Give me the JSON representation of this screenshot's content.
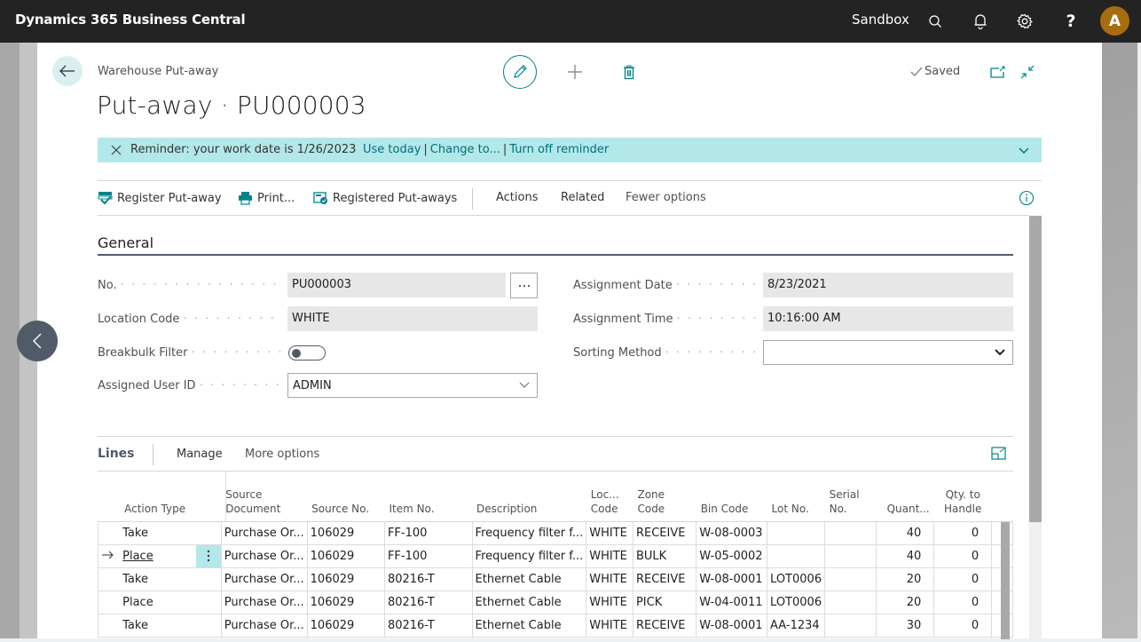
{
  "appbar": {
    "title": "Dynamics 365 Business Central",
    "environment": "Sandbox",
    "icons": [
      "search-icon",
      "bell-icon",
      "gear-icon",
      "help-icon"
    ],
    "help_glyph": "?",
    "avatar_initial": "A",
    "avatar_color": "#a86c10"
  },
  "header": {
    "breadcrumb": "Warehouse Put-away",
    "title": "Put-away · PU000003",
    "status": "Saved",
    "accent_color": "#00838a"
  },
  "reminder": {
    "message": "Reminder: your work date is 1/26/2023",
    "links": [
      "Use today",
      "Change to...",
      "Turn off reminder"
    ],
    "background": "#b3e8ea"
  },
  "actions": {
    "register": "Register Put-away",
    "print": "Print...",
    "registered": "Registered Put-aways",
    "actions": "Actions",
    "related": "Related",
    "fewer": "Fewer options"
  },
  "general": {
    "title": "General",
    "fields": {
      "no": {
        "label": "No.",
        "value": "PU000003"
      },
      "location_code": {
        "label": "Location Code",
        "value": "WHITE"
      },
      "breakbulk_filter": {
        "label": "Breakbulk Filter",
        "value": false
      },
      "assigned_user_id": {
        "label": "Assigned User ID",
        "value": "ADMIN"
      },
      "assignment_date": {
        "label": "Assignment Date",
        "value": "8/23/2021"
      },
      "assignment_time": {
        "label": "Assignment Time",
        "value": "10:16:00 AM"
      },
      "sorting_method": {
        "label": "Sorting Method",
        "value": ""
      }
    },
    "dots": "· · · · · · · · · · · · · · · · · · · · · · · · ·"
  },
  "lines": {
    "title": "Lines",
    "manage": "Manage",
    "more_options": "More options",
    "columns": [
      {
        "key": "action_type",
        "label": "Action Type"
      },
      {
        "key": "source_document",
        "label": "Source Document"
      },
      {
        "key": "source_no",
        "label": "Source No."
      },
      {
        "key": "item_no",
        "label": "Item No."
      },
      {
        "key": "description",
        "label": "Description"
      },
      {
        "key": "loc_code",
        "label": "Loc... Code"
      },
      {
        "key": "zone_code",
        "label": "Zone Code"
      },
      {
        "key": "bin_code",
        "label": "Bin Code"
      },
      {
        "key": "lot_no",
        "label": "Lot No."
      },
      {
        "key": "serial_no",
        "label": "Serial No."
      },
      {
        "key": "quantity",
        "label": "Quant..."
      },
      {
        "key": "qty_to_handle",
        "label": "Qty. to Handle"
      }
    ],
    "rows": [
      {
        "action_type": "Take",
        "source_document": "Purchase Or...",
        "source_no": "106029",
        "item_no": "FF-100",
        "description": "Frequency filter f...",
        "loc_code": "WHITE",
        "zone_code": "RECEIVE",
        "bin_code": "W-08-0003",
        "lot_no": "",
        "serial_no": "",
        "quantity": "40",
        "qty_to_handle": "0"
      },
      {
        "action_type": "Place",
        "source_document": "Purchase Or...",
        "source_no": "106029",
        "item_no": "FF-100",
        "description": "Frequency filter f...",
        "loc_code": "WHITE",
        "zone_code": "BULK",
        "bin_code": "W-05-0002",
        "lot_no": "",
        "serial_no": "",
        "quantity": "40",
        "qty_to_handle": "0"
      },
      {
        "action_type": "Take",
        "source_document": "Purchase Or...",
        "source_no": "106029",
        "item_no": "80216-T",
        "description": "Ethernet Cable",
        "loc_code": "WHITE",
        "zone_code": "RECEIVE",
        "bin_code": "W-08-0001",
        "lot_no": "LOT0006",
        "serial_no": "",
        "quantity": "20",
        "qty_to_handle": "0"
      },
      {
        "action_type": "Place",
        "source_document": "Purchase Or...",
        "source_no": "106029",
        "item_no": "80216-T",
        "description": "Ethernet Cable",
        "loc_code": "WHITE",
        "zone_code": "PICK",
        "bin_code": "W-04-0011",
        "lot_no": "LOT0006",
        "serial_no": "",
        "quantity": "20",
        "qty_to_handle": "0"
      },
      {
        "action_type": "Take",
        "source_document": "Purchase Or...",
        "source_no": "106029",
        "item_no": "80216-T",
        "description": "Ethernet Cable",
        "loc_code": "WHITE",
        "zone_code": "RECEIVE",
        "bin_code": "W-08-0001",
        "lot_no": "AA-1234",
        "serial_no": "",
        "quantity": "30",
        "qty_to_handle": "0"
      }
    ],
    "active_row": 1
  }
}
